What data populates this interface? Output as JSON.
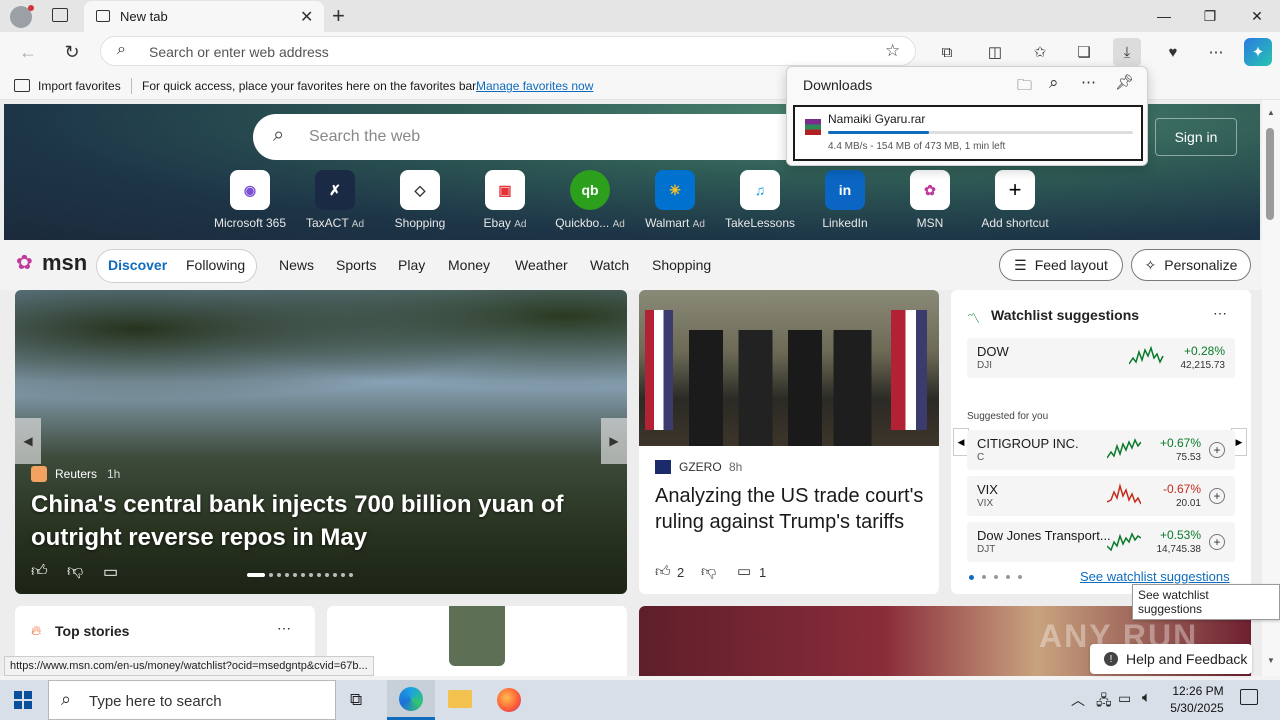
{
  "titlebar": {
    "tab_title": "New tab"
  },
  "toolbar": {
    "address_placeholder": "Search or enter web address"
  },
  "favbar": {
    "import_label": "Import favorites",
    "hint": "For quick access, place your favorites here on the favorites bar.",
    "manage_link": "Manage favorites now"
  },
  "downloads": {
    "title": "Downloads",
    "file": "Namaiki Gyaru.rar",
    "status": "4.4 MB/s - 154 MB of 473 MB, 1 min left",
    "progress": 0.33
  },
  "hero": {
    "search_placeholder": "Search the web",
    "signin": "Sign in"
  },
  "shortcuts": [
    {
      "label": "Microsoft 365",
      "ad": ""
    },
    {
      "label": "TaxACT",
      "ad": "Ad"
    },
    {
      "label": "Shopping",
      "ad": ""
    },
    {
      "label": "Ebay",
      "ad": "Ad"
    },
    {
      "label": "Quickbo...",
      "ad": "Ad"
    },
    {
      "label": "Walmart",
      "ad": "Ad"
    },
    {
      "label": "TakeLessons",
      "ad": ""
    },
    {
      "label": "LinkedIn",
      "ad": ""
    },
    {
      "label": "MSN",
      "ad": ""
    },
    {
      "label": "Add shortcut",
      "ad": ""
    }
  ],
  "msn": {
    "logo": "msn",
    "tabs": [
      "Discover",
      "Following"
    ],
    "nav": [
      "News",
      "Sports",
      "Play",
      "Money",
      "Weather",
      "Watch",
      "Shopping"
    ],
    "feed_layout": "Feed layout",
    "personalize": "Personalize"
  },
  "story1": {
    "source": "Reuters",
    "age": "1h",
    "title": "China's central bank injects 700 billion yuan of outright reverse repos in May"
  },
  "story2": {
    "source": "GZERO",
    "age": "8h",
    "title": "Analyzing the US trade court's ruling against Trump's tariffs",
    "likes": "2",
    "comments": "1"
  },
  "watchlist": {
    "title": "Watchlist suggestions",
    "main": {
      "symbol": "DOW",
      "sub": "DJI",
      "pct": "+0.28%",
      "value": "42,215.73"
    },
    "suggested_label": "Suggested for you",
    "items": [
      {
        "symbol": "CITIGROUP INC.",
        "sub": "C",
        "pct": "+0.67%",
        "value": "75.53"
      },
      {
        "symbol": "VIX",
        "sub": "VIX",
        "pct": "-0.67%",
        "value": "20.01"
      },
      {
        "symbol": "Dow Jones Transport...",
        "sub": "DJT",
        "pct": "+0.53%",
        "value": "14,745.38"
      }
    ],
    "see_link": "See watchlist suggestions",
    "tooltip": "See watchlist suggestions"
  },
  "top_stories": "Top stories",
  "help": "Help and Feedback",
  "watermark": "ANY RUN",
  "status_url": "https://www.msn.com/en-us/money/watchlist?ocid=msedgntp&cvid=67b...",
  "taskbar": {
    "search_placeholder": "Type here to search",
    "time": "12:26 PM",
    "date": "5/30/2025"
  },
  "colors": {
    "accent": "#0f6cbd",
    "up": "#0a7a2a",
    "down": "#c42b1c"
  }
}
